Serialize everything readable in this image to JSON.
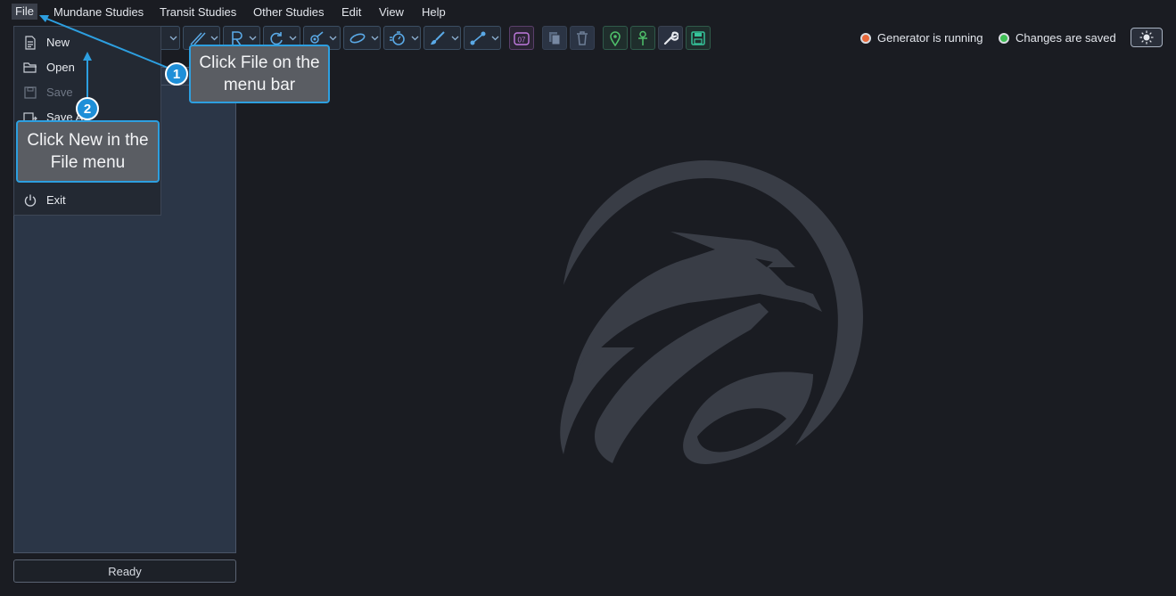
{
  "menubar": {
    "items": [
      "File",
      "Mundane Studies",
      "Transit Studies",
      "Other Studies",
      "Edit",
      "View",
      "Help"
    ]
  },
  "toolbar": {
    "calendar_label": "07"
  },
  "status": {
    "generator": "Generator is running",
    "changes": "Changes are saved",
    "generator_color": "#e8683a",
    "changes_color": "#3fbf55"
  },
  "file_menu": {
    "items": [
      {
        "label": "New",
        "icon": "new-file-icon",
        "enabled": true
      },
      {
        "label": "Open",
        "icon": "folder-open-icon",
        "enabled": true
      },
      {
        "label": "Save",
        "icon": "save-icon",
        "enabled": false
      },
      {
        "label": "Save A",
        "icon": "save-as-icon",
        "enabled": true
      },
      {
        "label": "Exit",
        "icon": "power-icon",
        "enabled": true
      }
    ]
  },
  "statusbar": {
    "ready": "Ready"
  },
  "callouts": [
    {
      "number": "1",
      "text": "Click File on the menu bar"
    },
    {
      "number": "2",
      "text": "Click New in the File menu"
    }
  ],
  "colors": {
    "accent": "#2d9fe0",
    "background": "#1a1c22",
    "panel": "#2b3647"
  }
}
